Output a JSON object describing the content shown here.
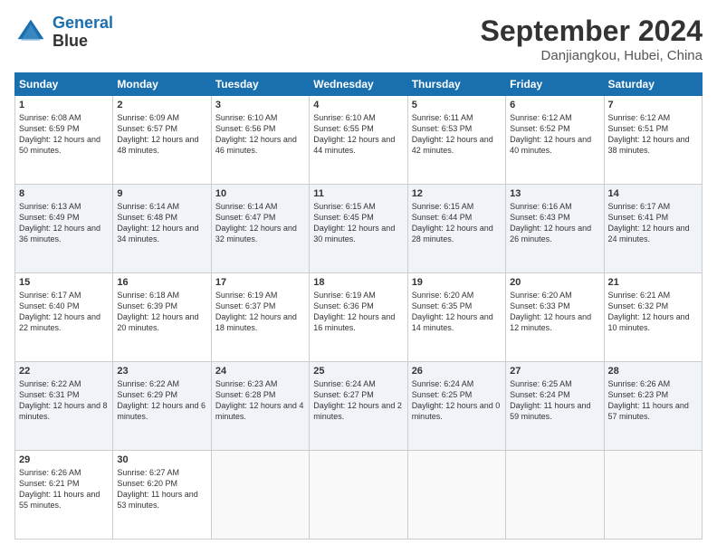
{
  "logo": {
    "line1": "General",
    "line2": "Blue"
  },
  "title": "September 2024",
  "location": "Danjiangkou, Hubei, China",
  "days_header": [
    "Sunday",
    "Monday",
    "Tuesday",
    "Wednesday",
    "Thursday",
    "Friday",
    "Saturday"
  ],
  "weeks": [
    [
      {
        "day": "1",
        "sunrise": "6:08 AM",
        "sunset": "6:59 PM",
        "daylight": "12 hours and 50 minutes."
      },
      {
        "day": "2",
        "sunrise": "6:09 AM",
        "sunset": "6:57 PM",
        "daylight": "12 hours and 48 minutes."
      },
      {
        "day": "3",
        "sunrise": "6:10 AM",
        "sunset": "6:56 PM",
        "daylight": "12 hours and 46 minutes."
      },
      {
        "day": "4",
        "sunrise": "6:10 AM",
        "sunset": "6:55 PM",
        "daylight": "12 hours and 44 minutes."
      },
      {
        "day": "5",
        "sunrise": "6:11 AM",
        "sunset": "6:53 PM",
        "daylight": "12 hours and 42 minutes."
      },
      {
        "day": "6",
        "sunrise": "6:12 AM",
        "sunset": "6:52 PM",
        "daylight": "12 hours and 40 minutes."
      },
      {
        "day": "7",
        "sunrise": "6:12 AM",
        "sunset": "6:51 PM",
        "daylight": "12 hours and 38 minutes."
      }
    ],
    [
      {
        "day": "8",
        "sunrise": "6:13 AM",
        "sunset": "6:49 PM",
        "daylight": "12 hours and 36 minutes."
      },
      {
        "day": "9",
        "sunrise": "6:14 AM",
        "sunset": "6:48 PM",
        "daylight": "12 hours and 34 minutes."
      },
      {
        "day": "10",
        "sunrise": "6:14 AM",
        "sunset": "6:47 PM",
        "daylight": "12 hours and 32 minutes."
      },
      {
        "day": "11",
        "sunrise": "6:15 AM",
        "sunset": "6:45 PM",
        "daylight": "12 hours and 30 minutes."
      },
      {
        "day": "12",
        "sunrise": "6:15 AM",
        "sunset": "6:44 PM",
        "daylight": "12 hours and 28 minutes."
      },
      {
        "day": "13",
        "sunrise": "6:16 AM",
        "sunset": "6:43 PM",
        "daylight": "12 hours and 26 minutes."
      },
      {
        "day": "14",
        "sunrise": "6:17 AM",
        "sunset": "6:41 PM",
        "daylight": "12 hours and 24 minutes."
      }
    ],
    [
      {
        "day": "15",
        "sunrise": "6:17 AM",
        "sunset": "6:40 PM",
        "daylight": "12 hours and 22 minutes."
      },
      {
        "day": "16",
        "sunrise": "6:18 AM",
        "sunset": "6:39 PM",
        "daylight": "12 hours and 20 minutes."
      },
      {
        "day": "17",
        "sunrise": "6:19 AM",
        "sunset": "6:37 PM",
        "daylight": "12 hours and 18 minutes."
      },
      {
        "day": "18",
        "sunrise": "6:19 AM",
        "sunset": "6:36 PM",
        "daylight": "12 hours and 16 minutes."
      },
      {
        "day": "19",
        "sunrise": "6:20 AM",
        "sunset": "6:35 PM",
        "daylight": "12 hours and 14 minutes."
      },
      {
        "day": "20",
        "sunrise": "6:20 AM",
        "sunset": "6:33 PM",
        "daylight": "12 hours and 12 minutes."
      },
      {
        "day": "21",
        "sunrise": "6:21 AM",
        "sunset": "6:32 PM",
        "daylight": "12 hours and 10 minutes."
      }
    ],
    [
      {
        "day": "22",
        "sunrise": "6:22 AM",
        "sunset": "6:31 PM",
        "daylight": "12 hours and 8 minutes."
      },
      {
        "day": "23",
        "sunrise": "6:22 AM",
        "sunset": "6:29 PM",
        "daylight": "12 hours and 6 minutes."
      },
      {
        "day": "24",
        "sunrise": "6:23 AM",
        "sunset": "6:28 PM",
        "daylight": "12 hours and 4 minutes."
      },
      {
        "day": "25",
        "sunrise": "6:24 AM",
        "sunset": "6:27 PM",
        "daylight": "12 hours and 2 minutes."
      },
      {
        "day": "26",
        "sunrise": "6:24 AM",
        "sunset": "6:25 PM",
        "daylight": "12 hours and 0 minutes."
      },
      {
        "day": "27",
        "sunrise": "6:25 AM",
        "sunset": "6:24 PM",
        "daylight": "11 hours and 59 minutes."
      },
      {
        "day": "28",
        "sunrise": "6:26 AM",
        "sunset": "6:23 PM",
        "daylight": "11 hours and 57 minutes."
      }
    ],
    [
      {
        "day": "29",
        "sunrise": "6:26 AM",
        "sunset": "6:21 PM",
        "daylight": "11 hours and 55 minutes."
      },
      {
        "day": "30",
        "sunrise": "6:27 AM",
        "sunset": "6:20 PM",
        "daylight": "11 hours and 53 minutes."
      },
      null,
      null,
      null,
      null,
      null
    ]
  ]
}
